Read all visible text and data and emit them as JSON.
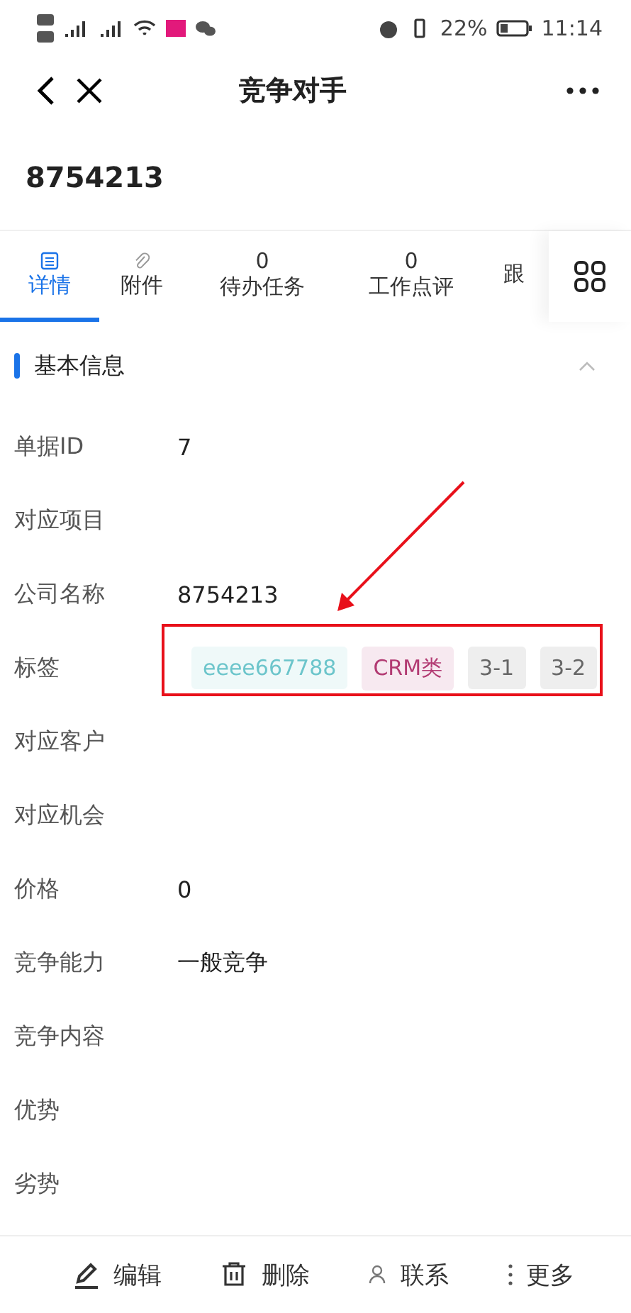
{
  "status_bar": {
    "battery": "22%",
    "time": "11:14"
  },
  "header": {
    "title": "竞争对手"
  },
  "record": {
    "name": "8754213"
  },
  "tabs": [
    {
      "label": "详情",
      "selected": true
    },
    {
      "label": "附件",
      "selected": false
    },
    {
      "label": "待办任务",
      "count": "0",
      "selected": false
    },
    {
      "label": "工作点评",
      "count": "0",
      "selected": false
    },
    {
      "label": "跟",
      "selected": false
    }
  ],
  "section": {
    "title": "基本信息",
    "expanded": true
  },
  "fields": [
    {
      "label": "单据ID",
      "value": "7"
    },
    {
      "label": "对应项目"
    },
    {
      "label": "公司名称",
      "value": "8754213"
    },
    {
      "label": "标签",
      "tags": [
        {
          "text": "eeee667788",
          "color": "#6cc5cb"
        },
        {
          "text": "CRM类",
          "color": "#b23a72"
        },
        {
          "text": "3-1",
          "color": "#666666"
        },
        {
          "text": "3-2",
          "color": "#666666"
        }
      ]
    },
    {
      "label": "对应客户"
    },
    {
      "label": "对应机会"
    },
    {
      "label": "价格",
      "value": "0"
    },
    {
      "label": "竞争能力",
      "value": "一般竞争"
    },
    {
      "label": "竞争内容"
    },
    {
      "label": "优势"
    },
    {
      "label": "劣势"
    }
  ],
  "actions": [
    {
      "label": "编辑"
    },
    {
      "label": "删除"
    },
    {
      "label": "联系"
    },
    {
      "label": "更多"
    }
  ]
}
